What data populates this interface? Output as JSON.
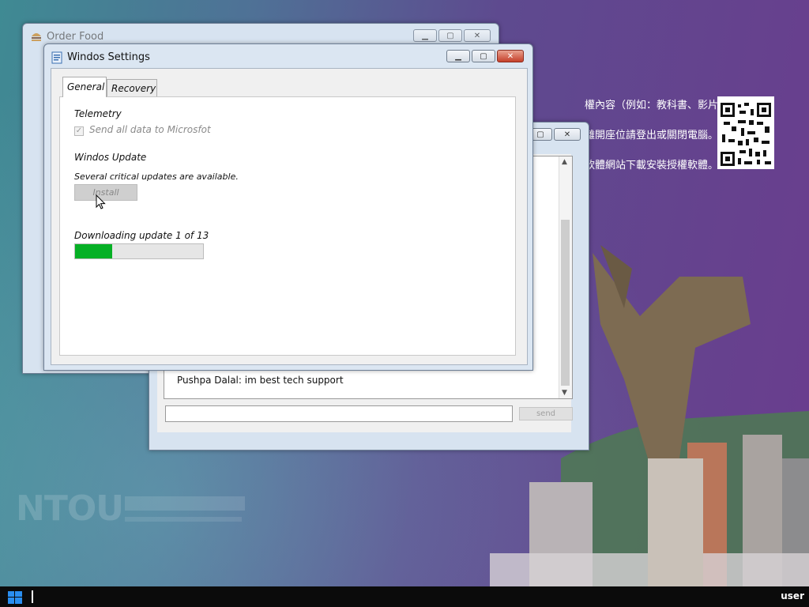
{
  "desktop": {
    "notice_lines": [
      "權內容（例如：教科書、影片、圖片等）。",
      "離開座位請登出或關閉電腦。",
      "軟體網站下載安裝授權軟體。"
    ],
    "watermark": "NTOU"
  },
  "order_food_window": {
    "title": "Order Food",
    "title_icon": "burger-icon"
  },
  "chat_window": {
    "message": "Pushpa Dalal: im best tech support",
    "input_value": "",
    "send_label": "send"
  },
  "settings_window": {
    "title": "Windos Settings",
    "title_icon": "settings-app-icon",
    "tabs": [
      {
        "label": "General",
        "active": true
      },
      {
        "label": "Recovery",
        "active": false
      }
    ],
    "telemetry": {
      "heading": "Telemetry",
      "checkbox_label": "Send all data to Microsfot",
      "checked": true,
      "disabled": true
    },
    "update": {
      "heading": "Windos Update",
      "status": "Several critical updates are available.",
      "install_label": "Install",
      "progress_text": "Downloading update 1 of 13",
      "progress_fraction": 0.29
    },
    "colors": {
      "progress": "#06b025",
      "close_button": "#c5402a"
    }
  },
  "taskbar": {
    "start_icon": "windows-start-icon",
    "user_label": "user"
  }
}
